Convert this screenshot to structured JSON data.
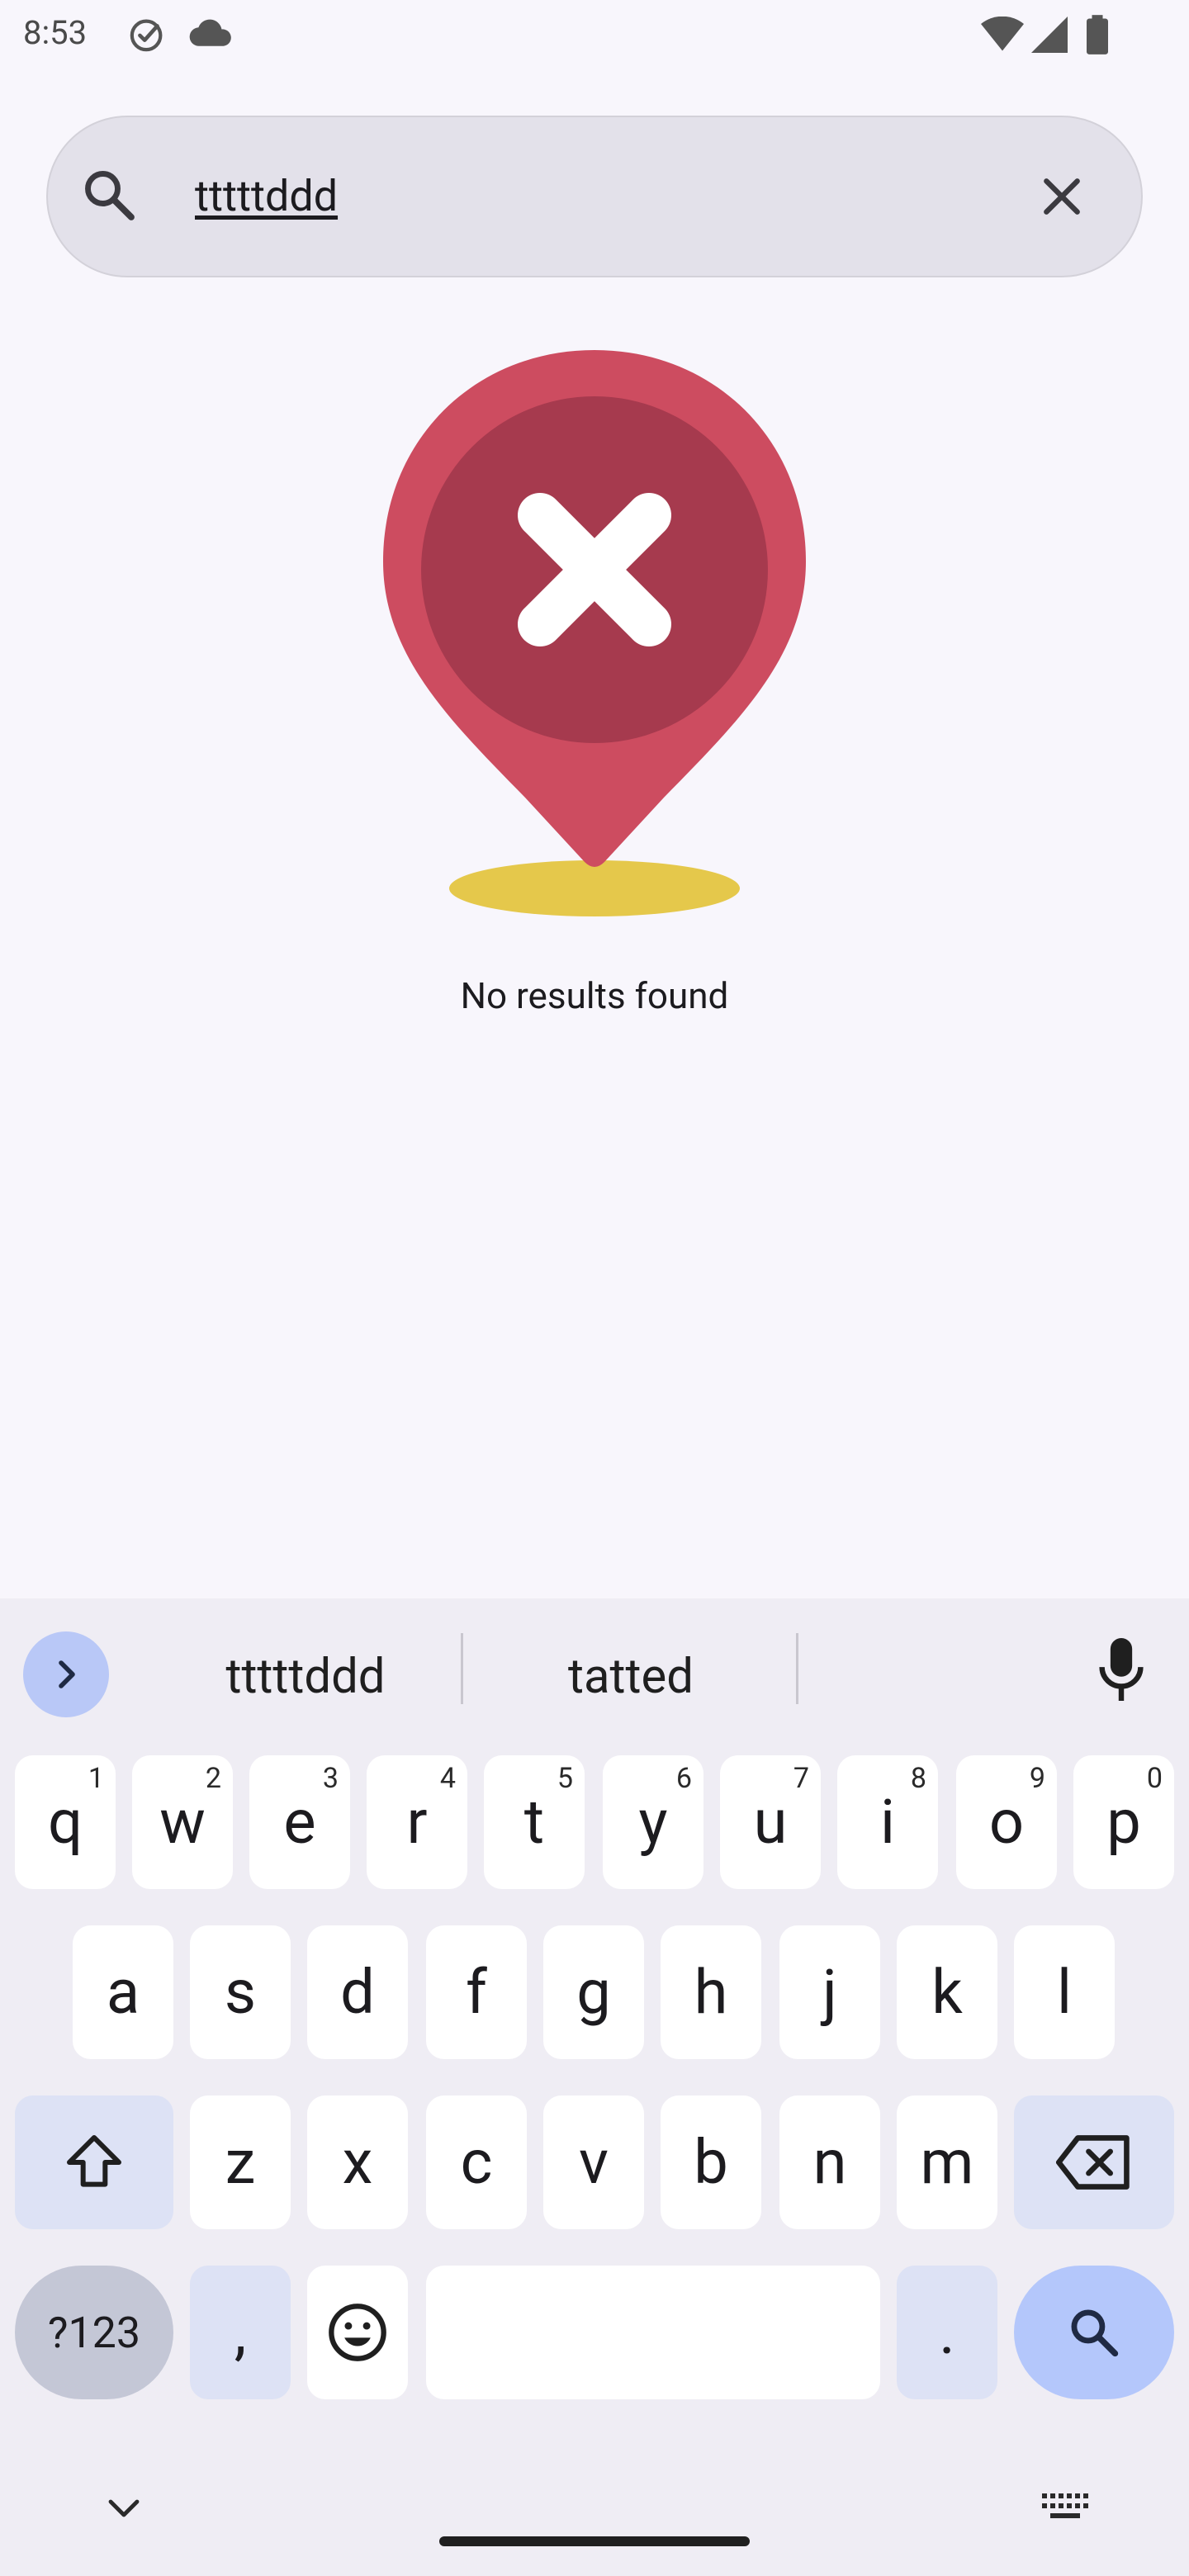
{
  "status_bar": {
    "time": "8:53",
    "icons": [
      "check-circle-icon",
      "cloud-icon",
      "wifi-icon",
      "cell-signal-icon",
      "battery-icon"
    ]
  },
  "search": {
    "value": "tttttddd",
    "icon": "search-icon",
    "clear_icon": "close-icon"
  },
  "empty_state": {
    "message": "No results found",
    "illustration": "map-pin-error-icon",
    "colors": {
      "pin": "#cd4c60",
      "pin_inner": "#a63a4e",
      "shadow": "#e5c84b"
    }
  },
  "keyboard": {
    "suggestions": [
      "tttttddd",
      "tatted"
    ],
    "row1": [
      {
        "key": "q",
        "hint": "1"
      },
      {
        "key": "w",
        "hint": "2"
      },
      {
        "key": "e",
        "hint": "3"
      },
      {
        "key": "r",
        "hint": "4"
      },
      {
        "key": "t",
        "hint": "5"
      },
      {
        "key": "y",
        "hint": "6"
      },
      {
        "key": "u",
        "hint": "7"
      },
      {
        "key": "i",
        "hint": "8"
      },
      {
        "key": "o",
        "hint": "9"
      },
      {
        "key": "p",
        "hint": "0"
      }
    ],
    "row2": [
      "a",
      "s",
      "d",
      "f",
      "g",
      "h",
      "j",
      "k",
      "l"
    ],
    "row3": [
      "z",
      "x",
      "c",
      "v",
      "b",
      "n",
      "m"
    ],
    "row4": {
      "symbols": "?123",
      "comma": ",",
      "period": "."
    },
    "accent_color": "#b4c7fb"
  }
}
